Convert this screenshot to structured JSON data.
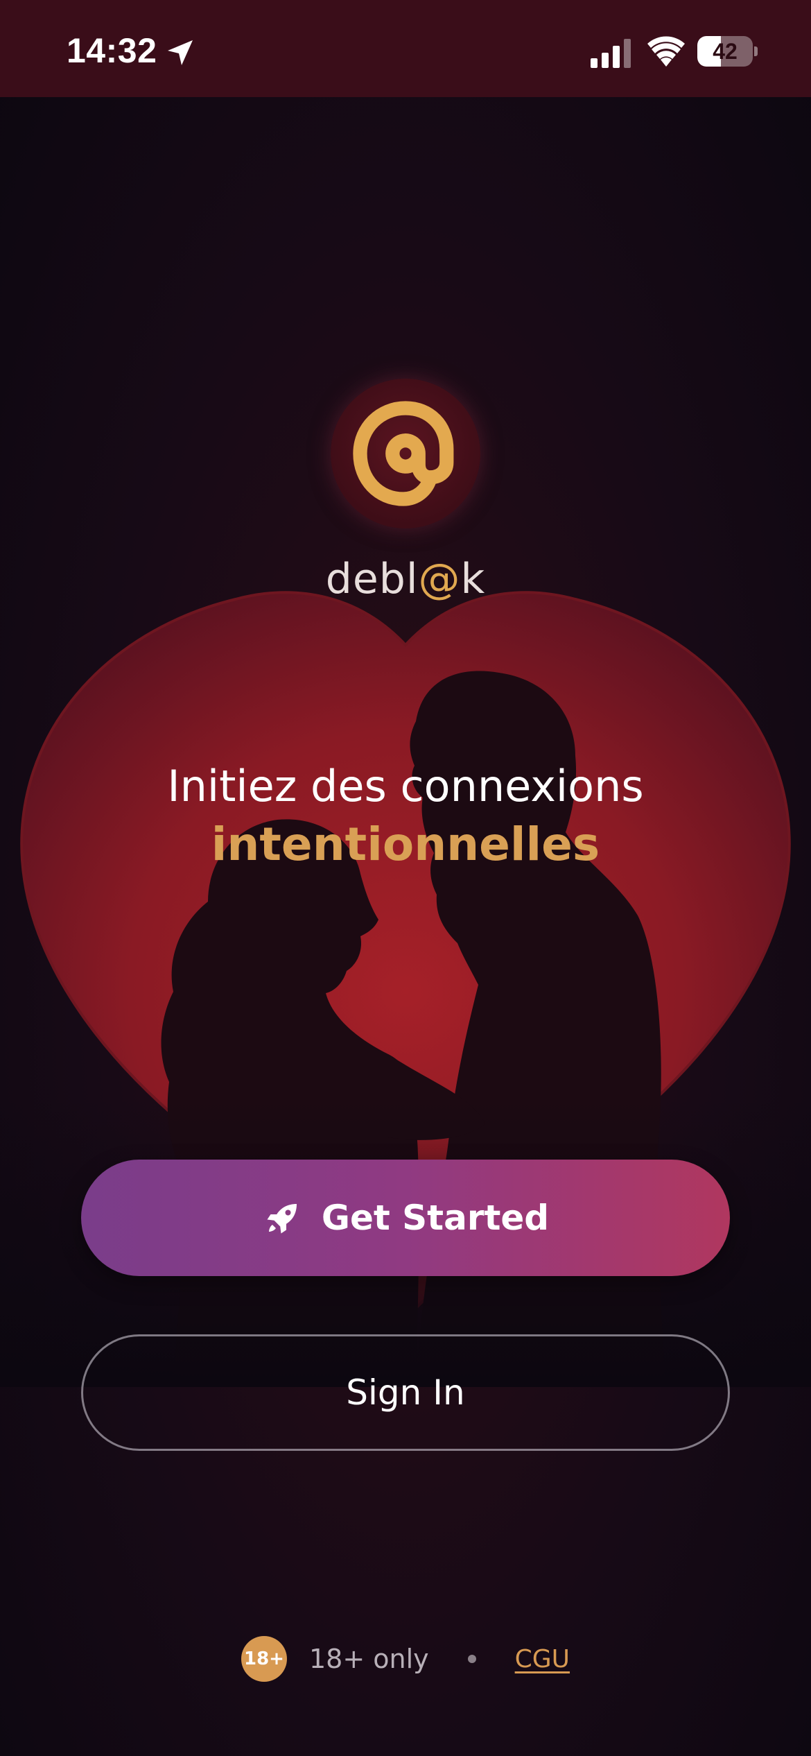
{
  "status_bar": {
    "time": "14:32",
    "battery_level": "42",
    "battery_fraction": 0.42,
    "icons": [
      "location-arrow-icon",
      "cellular-signal-icon",
      "wifi-icon",
      "battery-icon"
    ]
  },
  "brand": {
    "name_prefix": "debl",
    "name_accent": "@",
    "name_suffix": "k",
    "logo_icon": "at-sign-icon"
  },
  "hero": {
    "headline_line1": "Initiez des connexions",
    "headline_line2": "intentionnelles",
    "illustration": "heart-couple-silhouette"
  },
  "actions": {
    "get_started_label": "Get Started",
    "get_started_icon": "rocket-icon",
    "sign_in_label": "Sign In"
  },
  "footer": {
    "age_badge": "18+",
    "age_text": "18+ only",
    "cgu_label": "CGU"
  },
  "colors": {
    "status_bar_bg": "#3a0d19",
    "background": "#170a16",
    "accent_gold": "#d9a055",
    "heart_red": "#8e1a22",
    "button_gradient_start": "#7a3d8a",
    "button_gradient_end": "#b0375f",
    "text_white": "#ffffff"
  }
}
